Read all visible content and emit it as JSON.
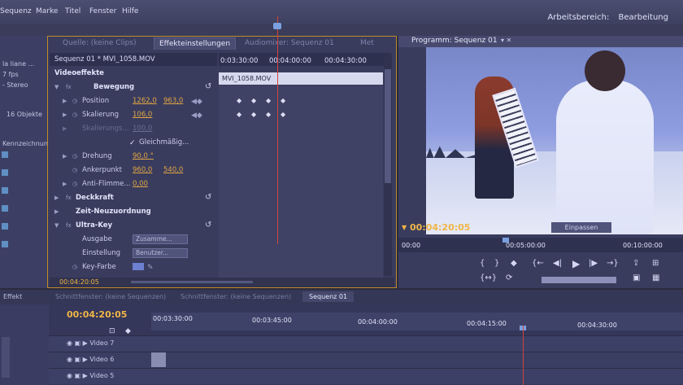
{
  "menu": [
    "Sequenz",
    "Marke",
    "Titel",
    "Fenster",
    "Hilfe"
  ],
  "workspace": {
    "label": "Arbeitsbereich:",
    "value": "Bearbeitung"
  },
  "project_panel": {
    "lines": [
      "la liane ...",
      "7 fps",
      "- Stereo",
      "16 Objekte",
      "Kennzeichnung"
    ]
  },
  "effect_panel": {
    "tabs": [
      "Quelle: (keine Clips)",
      "Effekteinstellungen",
      "Audiomixer: Sequenz 01",
      "Met"
    ],
    "sequence_label": "Sequenz 01 * MVI_1058.MOV",
    "clip_name": "MVI_1058.MOV",
    "section": "Videoeffekte",
    "ruler": [
      "0:03:30:00",
      "00:04:00:00",
      "00:04:30:00"
    ],
    "rows": [
      {
        "label": "Bewegung"
      },
      {
        "label": "Position",
        "v1": "1262,0",
        "v2": "963,0"
      },
      {
        "label": "Skalierung",
        "v1": "106,0"
      },
      {
        "label": "Skalierungs...",
        "v1": "100,0"
      },
      {
        "label": "Gleichmäßig..."
      },
      {
        "label": "Drehung",
        "v1": "90,0 °"
      },
      {
        "label": "Ankerpunkt",
        "v1": "960,0",
        "v2": "540,0"
      },
      {
        "label": "Anti-Flimme...",
        "v1": "0,00"
      },
      {
        "label": "Deckkraft"
      },
      {
        "label": "Zeit-Neuzuordnung"
      },
      {
        "label": "Ultra-Key"
      },
      {
        "label": "Ausgabe",
        "dd": "Zusamme..."
      },
      {
        "label": "Einstellung",
        "dd": "Benutzer..."
      },
      {
        "label": "Key-Farbe"
      }
    ],
    "footer_tc": "00:04:20:05"
  },
  "program_monitor": {
    "title": "Programm: Sequenz 01",
    "timecode": "00:04:20:05",
    "fit": "Einpassen",
    "ruler": [
      "00:00",
      "00:05:00:00",
      "00:10:00:00"
    ]
  },
  "timeline": {
    "left_tab": "Effekt",
    "tabs": [
      "Schnittfenster: (keine Sequenzen)",
      "Schnittfenster: (keine Sequenzen)",
      "Sequenz 01"
    ],
    "timecode": "00:04:20:05",
    "ruler": [
      "00:03:30:00",
      "00:03:45:00",
      "00:04:00:00",
      "00:04:15:00",
      "00:04:30:00"
    ],
    "tracks": [
      "Video 7",
      "Video 6",
      "Video 5"
    ]
  }
}
